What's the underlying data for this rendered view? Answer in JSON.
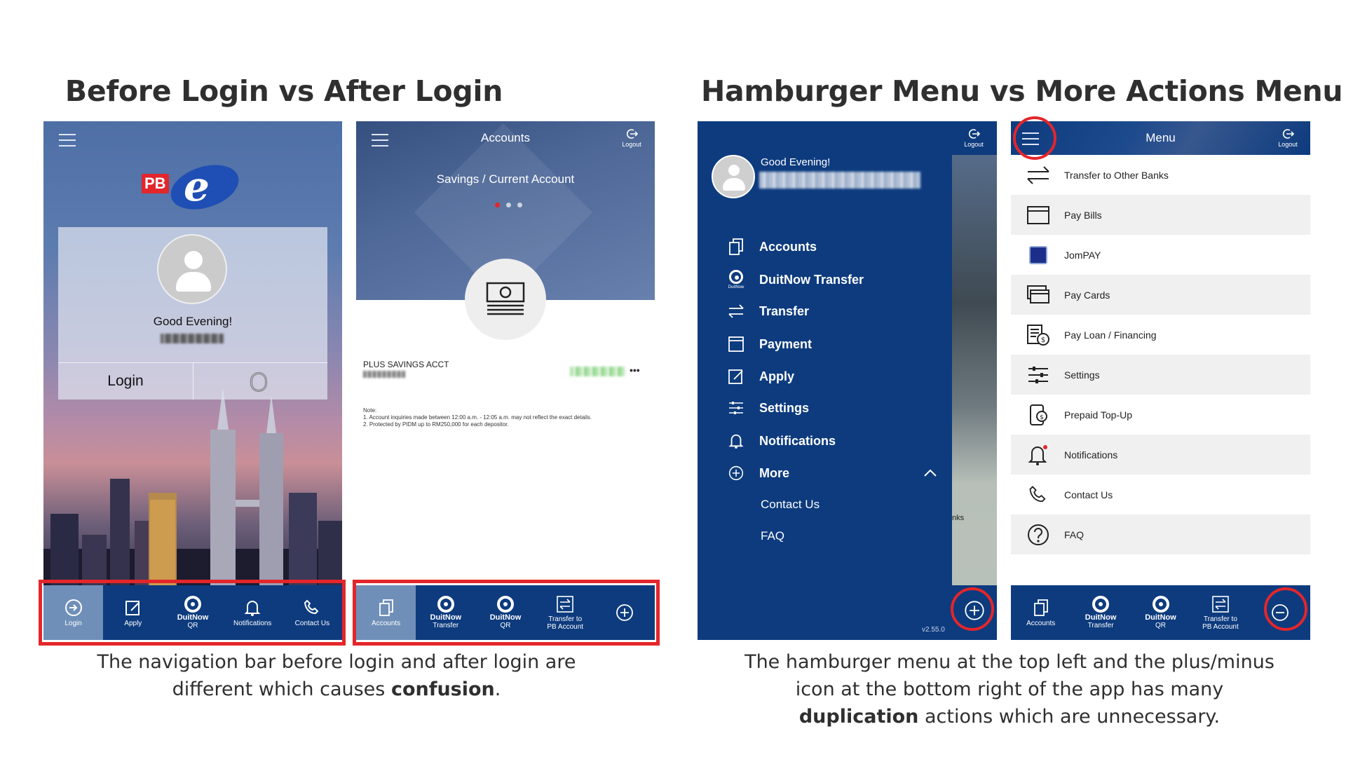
{
  "headings": {
    "left": "Before Login vs After Login",
    "right": "Hamburger Menu vs More Actions Menu"
  },
  "captions": {
    "left": {
      "pre": "The navigation bar before login and after login are different which causes ",
      "bold": "confusion",
      "post": "."
    },
    "right": {
      "pre": "The hamburger menu at the top left and the plus/minus icon at the bottom right of the app has many ",
      "bold": "duplication",
      "post": " actions which are unnecessary."
    }
  },
  "screen1": {
    "logo_text": "PB",
    "logo_e": "e",
    "greeting": "Good Evening!",
    "login_button": "Login",
    "navbar": [
      {
        "label": "Login",
        "icon": "login-icon",
        "active": true
      },
      {
        "label": "Apply",
        "icon": "apply-icon"
      },
      {
        "label": "DuitNow",
        "sublabel": "QR",
        "icon": "duitnow-icon"
      },
      {
        "label": "Notifications",
        "icon": "bell-icon"
      },
      {
        "label": "Contact Us",
        "icon": "phone-icon"
      }
    ]
  },
  "screen2": {
    "title": "Accounts",
    "logout": "Logout",
    "account_type": "Savings / Current Account",
    "account_name": "PLUS SAVINGS ACCT",
    "more": "•••",
    "note_title": "Note:",
    "note_1": "1. Account inquiries made between 12:00 a.m. - 12:05 a.m. may not reflect the exact details.",
    "note_2": "2. Protected by PIDM up to RM250,000 for each depositor.",
    "navbar": [
      {
        "label": "Accounts",
        "icon": "accounts-icon",
        "active": true
      },
      {
        "label": "DuitNow",
        "sublabel": "Transfer",
        "icon": "duitnow-icon"
      },
      {
        "label": "DuitNow",
        "sublabel": "QR",
        "icon": "duitnow-icon"
      },
      {
        "label": "Transfer to",
        "sublabel": "PB Account",
        "icon": "transfer-icon"
      },
      {
        "label": "",
        "icon": "plus-circle-icon"
      }
    ]
  },
  "screen3": {
    "logout": "Logout",
    "greeting": "Good Evening!",
    "items": [
      {
        "label": "Accounts",
        "icon": "accounts-icon"
      },
      {
        "label": "DuitNow Transfer",
        "icon": "duitnow-icon",
        "sub": "DuitNow"
      },
      {
        "label": "Transfer",
        "icon": "transfer-icon"
      },
      {
        "label": "Payment",
        "icon": "payment-icon"
      },
      {
        "label": "Apply",
        "icon": "apply-icon"
      },
      {
        "label": "Settings",
        "icon": "settings-icon"
      },
      {
        "label": "Notifications",
        "icon": "bell-icon"
      },
      {
        "label": "More",
        "icon": "plus-circle-icon"
      }
    ],
    "sub_items": [
      "Contact Us",
      "FAQ"
    ],
    "version": "v2.55.0",
    "peek_text": "nks"
  },
  "screen4": {
    "title": "Menu",
    "logout": "Logout",
    "items": [
      {
        "label": "Transfer to Other Banks",
        "icon": "transfer-icon"
      },
      {
        "label": "Pay Bills",
        "icon": "bill-icon"
      },
      {
        "label": "JomPAY",
        "icon": "jompay-icon"
      },
      {
        "label": "Pay Cards",
        "icon": "card-icon"
      },
      {
        "label": "Pay Loan / Financing",
        "icon": "loan-icon"
      },
      {
        "label": "Settings",
        "icon": "settings-icon"
      },
      {
        "label": "Prepaid Top-Up",
        "icon": "prepaid-icon"
      },
      {
        "label": "Notifications",
        "icon": "bell-icon"
      },
      {
        "label": "Contact Us",
        "icon": "phone-icon"
      },
      {
        "label": "FAQ",
        "icon": "help-icon"
      }
    ],
    "navbar": [
      {
        "label": "Accounts",
        "icon": "accounts-icon"
      },
      {
        "label": "DuitNow",
        "sublabel": "Transfer",
        "icon": "duitnow-icon"
      },
      {
        "label": "DuitNow",
        "sublabel": "QR",
        "icon": "duitnow-icon"
      },
      {
        "label": "Transfer to",
        "sublabel": "PB Account",
        "icon": "transfer-icon"
      },
      {
        "label": "",
        "icon": "minus-circle-icon"
      }
    ]
  },
  "colors": {
    "navy": "#0d3b7e",
    "highlight_red": "#e3262b",
    "active_tab": "#6f8fb8"
  }
}
